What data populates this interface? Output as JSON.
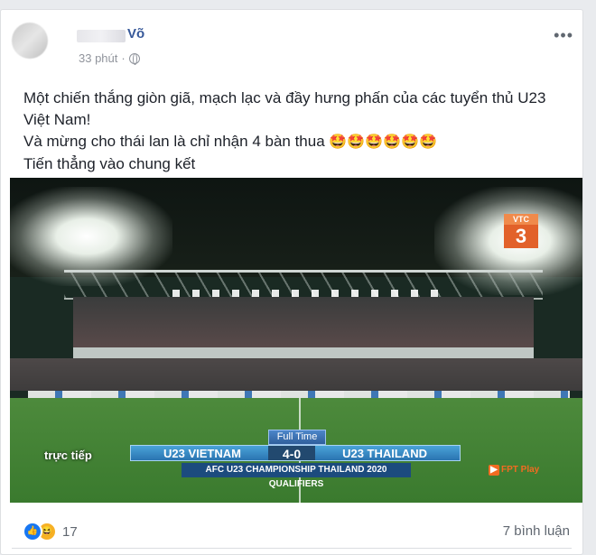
{
  "post": {
    "author_suffix": "Võ",
    "time": "33 phút",
    "separator": "·",
    "lines": [
      "Một chiến thắng giòn giã, mạch lạc và đầy hưng phấn của các tuyển thủ U23 Việt Nam!",
      "Và mừng cho thái lan là chỉ nhận 4 bàn thua",
      "Tiến thẳng vào chung kết"
    ],
    "emojis": "🤩🤩🤩🤩🤩🤩"
  },
  "photo": {
    "channel_label": "VTC",
    "channel_number": "3",
    "status": "Full Time",
    "team_home": "U23 VIETNAM",
    "score": "4-0",
    "team_away": "U23 THAILAND",
    "competition": "AFC U23 CHAMPIONSHIP THAILAND 2020 QUALIFIERS",
    "live_label": "trực tiếp",
    "provider": "FPT Play"
  },
  "footer": {
    "reactions_count": "17",
    "comments": "7 bình luận",
    "reaction_icons": [
      "like-icon",
      "haha-icon"
    ]
  }
}
